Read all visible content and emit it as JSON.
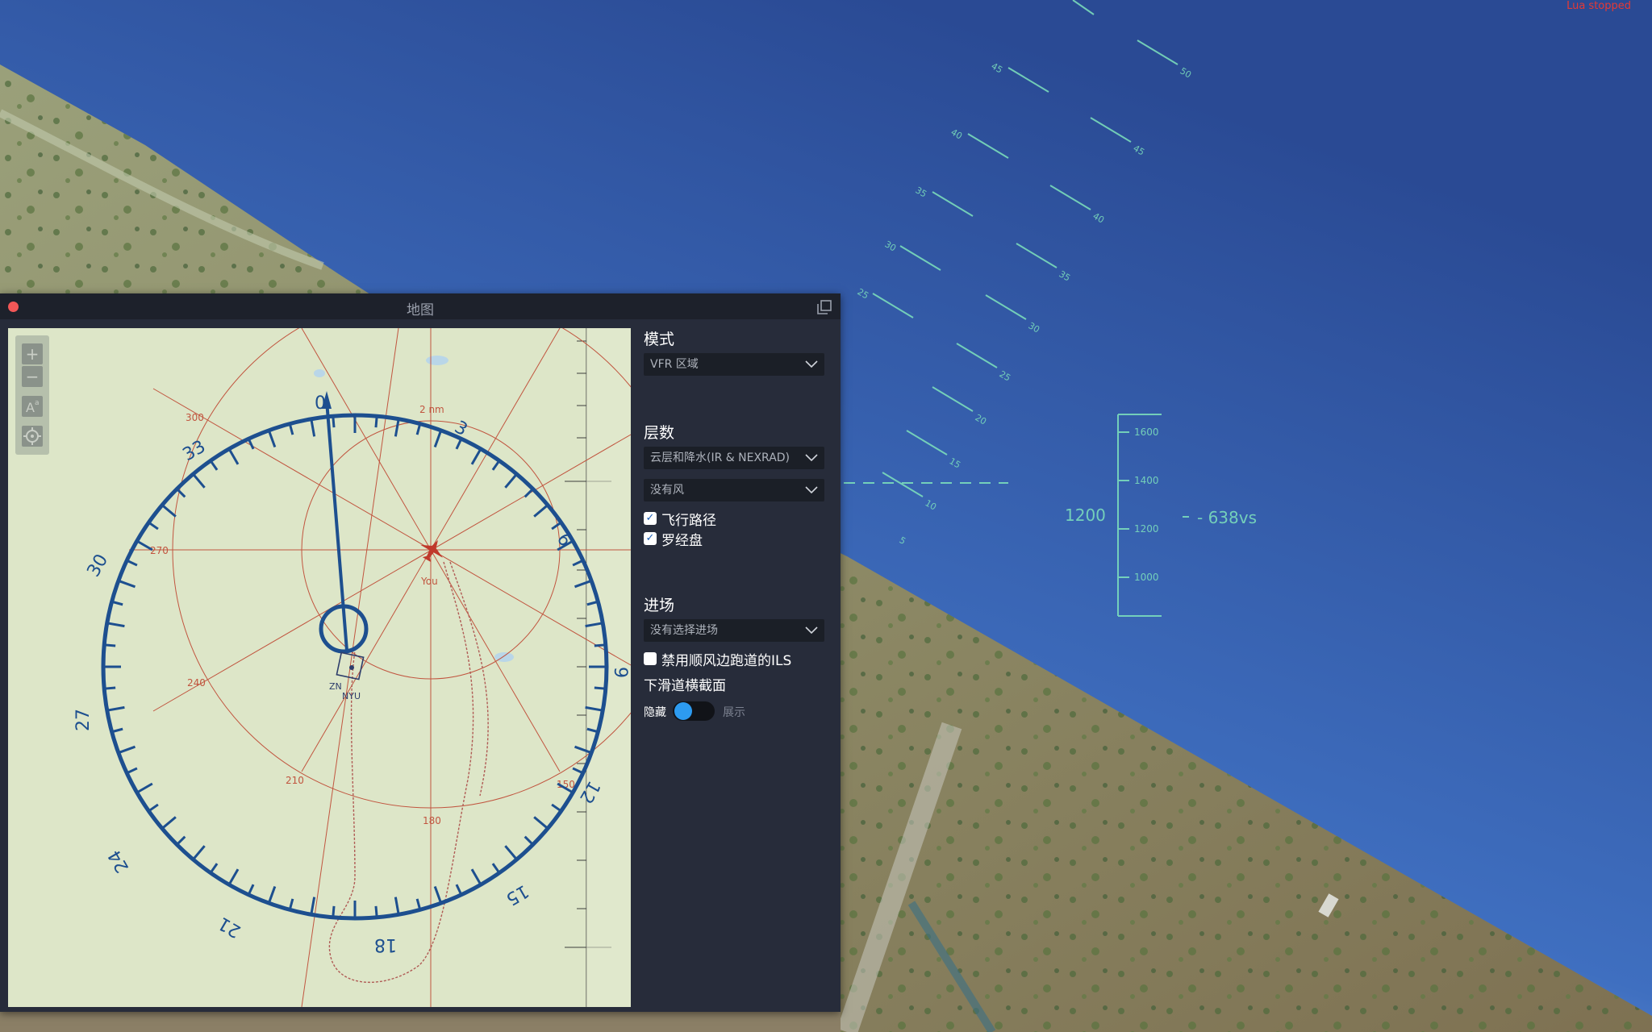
{
  "sim": {
    "lua_status": "Lua stopped"
  },
  "hud": {
    "pitch_left_labels": [
      "45",
      "40",
      "35",
      "30",
      "25"
    ],
    "pitch_right_labels": [
      "50",
      "45",
      "40",
      "35",
      "30",
      "25",
      "20",
      "15",
      "10",
      "5"
    ],
    "alt_ticks": [
      "1600",
      "1400",
      "1200",
      "1000"
    ],
    "altitude": "1200",
    "vertical_speed": "- 638vs"
  },
  "map_window": {
    "title": "地图",
    "zoom_in_label": "+",
    "zoom_out_label": "−",
    "compass": {
      "cardinal_labels": [
        "0",
        "3",
        "6",
        "9",
        "12",
        "15",
        "18",
        "21",
        "24",
        "27",
        "30",
        "33"
      ],
      "range_ring_labels": [
        "300",
        "270",
        "240",
        "210",
        "180",
        "150"
      ],
      "range_label": "2 nm",
      "aircraft_label": "You",
      "waypoint_labels": [
        "ZN",
        "NYU"
      ]
    },
    "side_panel": {
      "mode_title": "模式",
      "mode_value": "VFR 区域",
      "layers_title": "层数",
      "layer_weather": "云层和降水(IR & NEXRAD)",
      "layer_wind": "没有风",
      "checkbox_flight_path": "飞行路径",
      "checkbox_compass": "罗经盘",
      "approach_title": "进场",
      "approach_value": "没有选择进场",
      "checkbox_disable_ils": "禁用顺风边跑道的ILS",
      "glideslope_title": "下滑道横截面",
      "toggle_hide": "隐藏",
      "toggle_show": "展示"
    }
  },
  "colors": {
    "sky_top": "#2a4f98",
    "hud_green": "#7fe3bc",
    "map_bg": "#dde6c8",
    "compass_blue": "#1d4f8f",
    "grid_red": "#c1553f",
    "panel_bg": "#272c3a",
    "toggle_blue": "#2d9bf0"
  }
}
